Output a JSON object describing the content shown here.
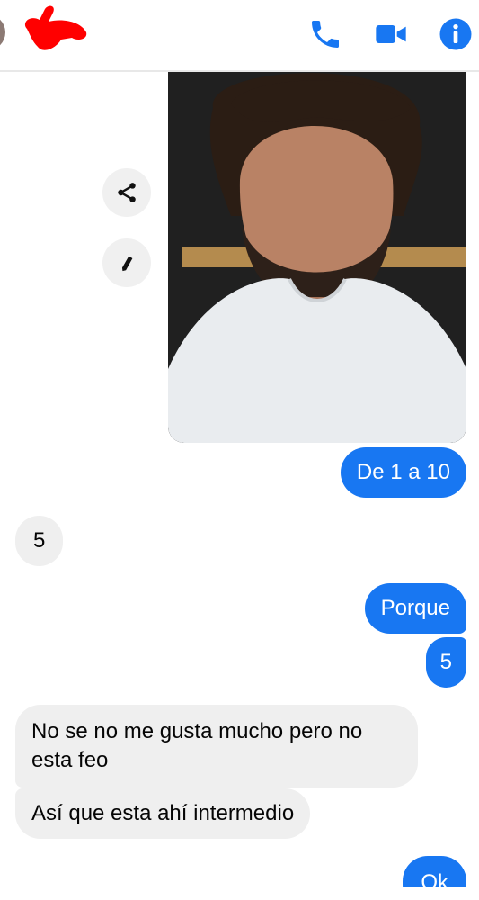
{
  "header": {
    "icons": [
      "phone-icon",
      "video-camera-icon",
      "info-icon"
    ],
    "accent_color": "#1877f2",
    "redaction_color": "#ff0000"
  },
  "image_actions": [
    "share-icon",
    "pencil-icon"
  ],
  "messages": [
    {
      "direction": "outgoing",
      "text": "De 1 a 10"
    },
    {
      "direction": "incoming",
      "text": "5"
    },
    {
      "direction": "outgoing",
      "text": "Porque"
    },
    {
      "direction": "outgoing",
      "text": "5"
    },
    {
      "direction": "incoming",
      "text": "No se no me gusta mucho pero no\nesta feo"
    },
    {
      "direction": "incoming",
      "text": "Así que esta ahí intermedio"
    },
    {
      "direction": "outgoing",
      "text": "Ok"
    }
  ],
  "colors": {
    "outgoing_bubble": "#1877f2",
    "incoming_bubble": "#efefef"
  }
}
